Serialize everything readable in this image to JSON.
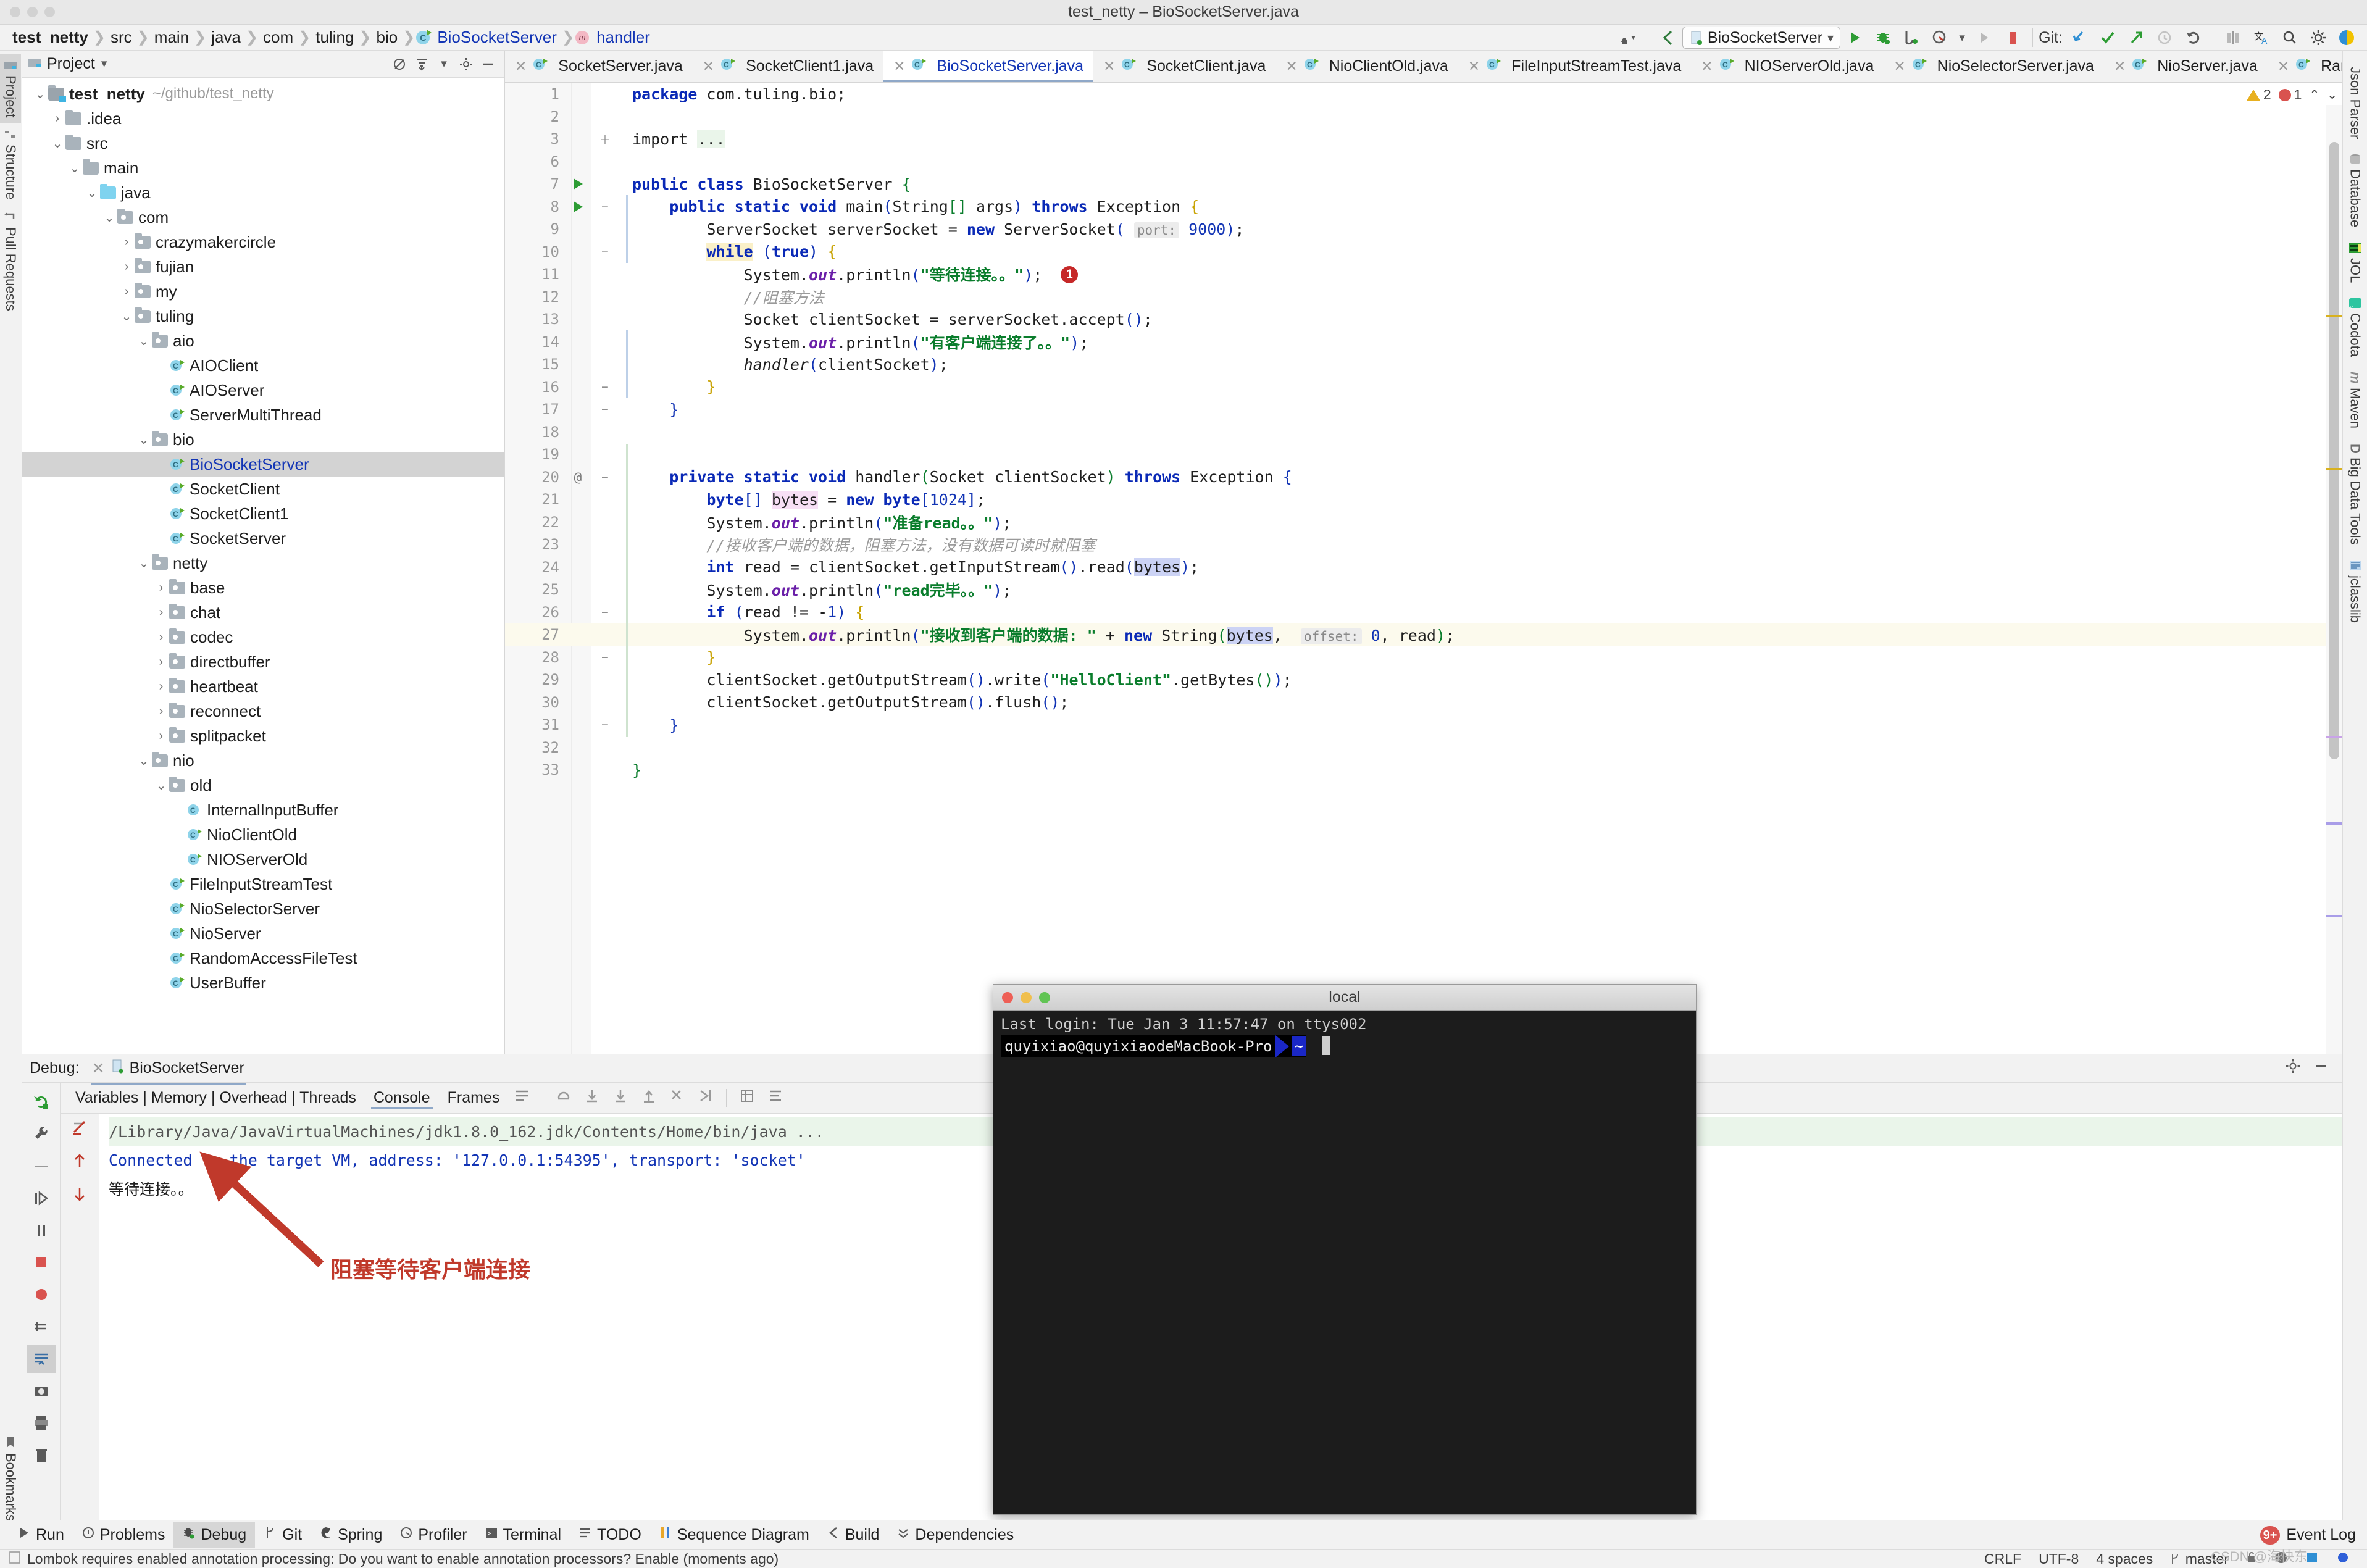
{
  "window": {
    "title": "test_netty – BioSocketServer.java"
  },
  "breadcrumb": {
    "items": [
      {
        "label": "test_netty",
        "kind": "project"
      },
      {
        "label": "src",
        "kind": "dir"
      },
      {
        "label": "main",
        "kind": "dir"
      },
      {
        "label": "java",
        "kind": "dir"
      },
      {
        "label": "com",
        "kind": "dir"
      },
      {
        "label": "tuling",
        "kind": "dir"
      },
      {
        "label": "bio",
        "kind": "dir"
      },
      {
        "label": "BioSocketServer",
        "kind": "class"
      },
      {
        "label": "handler",
        "kind": "method"
      }
    ]
  },
  "toolbar": {
    "run_config": "BioSocketServer",
    "git_label": "Git:",
    "icons": [
      "profiler-icon",
      "back-icon",
      "run-config-dropdown",
      "run-icon",
      "debug-icon",
      "run-with-coverage-icon",
      "profile-icon",
      "rerun-icon",
      "stop-icon",
      "git-update-icon",
      "git-commit-icon",
      "git-push-icon",
      "git-history-icon",
      "git-rollback-icon",
      "diff-icon",
      "translate-icon",
      "search-icon",
      "settings-icon",
      "ide-icon"
    ]
  },
  "left_strip": {
    "items": [
      {
        "label": "Project",
        "icon": "project-icon",
        "active": true
      },
      {
        "label": "Structure",
        "icon": "structure-icon",
        "active": false
      },
      {
        "label": "Pull Requests",
        "icon": "pull-requests-icon",
        "active": false
      },
      {
        "label": "Bookmarks",
        "icon": "bookmarks-icon",
        "active": false
      }
    ]
  },
  "right_strip": {
    "items": [
      {
        "label": "Json Parser",
        "icon": "json-parser-icon"
      },
      {
        "label": "Database",
        "icon": "database-icon"
      },
      {
        "label": "JOL",
        "icon": "jol-icon"
      },
      {
        "label": "Codota",
        "icon": "codota-icon"
      },
      {
        "label": "Maven",
        "icon": "maven-icon"
      },
      {
        "label": "Big Data Tools",
        "icon": "big-data-tools-icon"
      },
      {
        "label": "jclasslib",
        "icon": "jclasslib-icon"
      }
    ]
  },
  "project_panel": {
    "title": "Project",
    "header_icons": [
      "collapse-all-icon",
      "expand-all-icon",
      "options-icon",
      "settings-icon",
      "hide-icon"
    ],
    "tree": [
      {
        "depth": 0,
        "label": "test_netty",
        "sub": "~/github/test_netty",
        "icon": "project-folder",
        "arrow": "down",
        "bold": true
      },
      {
        "depth": 1,
        "label": ".idea",
        "icon": "folder",
        "arrow": "right"
      },
      {
        "depth": 1,
        "label": "src",
        "icon": "folder",
        "arrow": "down"
      },
      {
        "depth": 2,
        "label": "main",
        "icon": "folder",
        "arrow": "down"
      },
      {
        "depth": 3,
        "label": "java",
        "icon": "source-folder",
        "arrow": "down"
      },
      {
        "depth": 4,
        "label": "com",
        "icon": "package",
        "arrow": "down"
      },
      {
        "depth": 5,
        "label": "crazymakercircle",
        "icon": "package",
        "arrow": "right"
      },
      {
        "depth": 5,
        "label": "fujian",
        "icon": "package",
        "arrow": "right"
      },
      {
        "depth": 5,
        "label": "my",
        "icon": "package",
        "arrow": "right"
      },
      {
        "depth": 5,
        "label": "tuling",
        "icon": "package",
        "arrow": "down"
      },
      {
        "depth": 6,
        "label": "aio",
        "icon": "package",
        "arrow": "down"
      },
      {
        "depth": 7,
        "label": "AIOClient",
        "icon": "java-class",
        "arrow": ""
      },
      {
        "depth": 7,
        "label": "AIOServer",
        "icon": "java-class",
        "arrow": ""
      },
      {
        "depth": 7,
        "label": "ServerMultiThread",
        "icon": "java-class",
        "arrow": ""
      },
      {
        "depth": 6,
        "label": "bio",
        "icon": "package",
        "arrow": "down"
      },
      {
        "depth": 7,
        "label": "BioSocketServer",
        "icon": "java-class",
        "arrow": "",
        "selected": true
      },
      {
        "depth": 7,
        "label": "SocketClient",
        "icon": "java-class",
        "arrow": ""
      },
      {
        "depth": 7,
        "label": "SocketClient1",
        "icon": "java-class",
        "arrow": ""
      },
      {
        "depth": 7,
        "label": "SocketServer",
        "icon": "java-class",
        "arrow": ""
      },
      {
        "depth": 6,
        "label": "netty",
        "icon": "package",
        "arrow": "down"
      },
      {
        "depth": 7,
        "label": "base",
        "icon": "package",
        "arrow": "right"
      },
      {
        "depth": 7,
        "label": "chat",
        "icon": "package",
        "arrow": "right"
      },
      {
        "depth": 7,
        "label": "codec",
        "icon": "package",
        "arrow": "right"
      },
      {
        "depth": 7,
        "label": "directbuffer",
        "icon": "package",
        "arrow": "right"
      },
      {
        "depth": 7,
        "label": "heartbeat",
        "icon": "package",
        "arrow": "right"
      },
      {
        "depth": 7,
        "label": "reconnect",
        "icon": "package",
        "arrow": "right"
      },
      {
        "depth": 7,
        "label": "splitpacket",
        "icon": "package",
        "arrow": "right"
      },
      {
        "depth": 6,
        "label": "nio",
        "icon": "package",
        "arrow": "down"
      },
      {
        "depth": 7,
        "label": "old",
        "icon": "package",
        "arrow": "down"
      },
      {
        "depth": 8,
        "label": "InternalInputBuffer",
        "icon": "java-class-plain",
        "arrow": ""
      },
      {
        "depth": 8,
        "label": "NioClientOld",
        "icon": "java-class",
        "arrow": ""
      },
      {
        "depth": 8,
        "label": "NIOServerOld",
        "icon": "java-class",
        "arrow": ""
      },
      {
        "depth": 7,
        "label": "FileInputStreamTest",
        "icon": "java-class",
        "arrow": ""
      },
      {
        "depth": 7,
        "label": "NioSelectorServer",
        "icon": "java-class",
        "arrow": ""
      },
      {
        "depth": 7,
        "label": "NioServer",
        "icon": "java-class",
        "arrow": ""
      },
      {
        "depth": 7,
        "label": "RandomAccessFileTest",
        "icon": "java-class",
        "arrow": ""
      },
      {
        "depth": 7,
        "label": "UserBuffer",
        "icon": "java-class",
        "arrow": ""
      }
    ]
  },
  "editor": {
    "tabs": [
      {
        "label": "SocketServer.java",
        "active": false
      },
      {
        "label": "SocketClient1.java",
        "active": false
      },
      {
        "label": "BioSocketServer.java",
        "active": true
      },
      {
        "label": "SocketClient.java",
        "active": false
      },
      {
        "label": "NioClientOld.java",
        "active": false
      },
      {
        "label": "FileInputStreamTest.java",
        "active": false
      },
      {
        "label": "NIOServerOld.java",
        "active": false
      },
      {
        "label": "NioSelectorServer.java",
        "active": false
      },
      {
        "label": "NioServer.java",
        "active": false
      },
      {
        "label": "RandomA",
        "active": false
      }
    ],
    "inspections": {
      "warnings": "2",
      "errors": "1"
    },
    "line_numbers": [
      1,
      2,
      3,
      6,
      7,
      8,
      9,
      10,
      11,
      12,
      13,
      14,
      15,
      16,
      17,
      18,
      19,
      20,
      21,
      22,
      23,
      24,
      25,
      26,
      27,
      28,
      29,
      30,
      31,
      32,
      33
    ],
    "code_plain": [
      "package com.tuling.bio;",
      "",
      "import ...",
      "",
      "public class BioSocketServer {",
      "    public static void main(String[] args) throws Exception {",
      "        ServerSocket serverSocket = new ServerSocket( port: 9000);",
      "        while (true) {",
      "            System.out.println(\"等待连接。。\");",
      "            //阻塞方法",
      "            Socket clientSocket = serverSocket.accept();",
      "            System.out.println(\"有客户端连接了。。\");",
      "            handler(clientSocket);",
      "        }",
      "    }",
      "",
      "",
      "    private static void handler(Socket clientSocket) throws Exception {",
      "        byte[] bytes = new byte[1024];",
      "        System.out.println(\"准备read。。\");",
      "        //接收客户端的数据，阻塞方法，没有数据可读时就阻塞",
      "        int read = clientSocket.getInputStream().read(bytes);",
      "        System.out.println(\"read完毕。。\");",
      "        if (read != -1) {",
      "            System.out.println(\"接收到客户端的数据: \" + new String(bytes,  offset: 0, read);",
      "        }",
      "        clientSocket.getOutputStream().write(\"HelloClient\".getBytes());",
      "        clientSocket.getOutputStream().flush();",
      "    }",
      "",
      "}"
    ],
    "marker_badge": "1",
    "hints": {
      "port": "port:",
      "offset": "offset:"
    }
  },
  "debug": {
    "label": "Debug:",
    "session": "BioSocketServer",
    "tabs": [
      {
        "label": "Variables | Memory | Overhead | Threads",
        "active": false
      },
      {
        "label": "Console",
        "active": true
      },
      {
        "label": "Frames",
        "active": false
      }
    ],
    "console_lines": [
      {
        "text": "/Library/Java/JavaVirtualMachines/jdk1.8.0_162.jdk/Contents/Home/bin/java ...",
        "kind": "cmd"
      },
      {
        "text": "Connected to the target VM, address: '127.0.0.1:54395', transport: 'socket'",
        "kind": "conn"
      },
      {
        "text": "等待连接。。",
        "kind": "out"
      }
    ],
    "side_icons": [
      "rerun-icon",
      "settings-wrench-icon",
      "mute-icon",
      "resume-icon",
      "pause-icon",
      "stop-icon",
      "view-breakpoints-icon",
      "mute-breakpoints-icon",
      "layout-icon",
      "camera-icon",
      "print-icon",
      "trash-icon"
    ],
    "gutter_icons": [
      "soft-wrap-icon",
      "scroll-to-end-icon",
      "up-icon",
      "down-icon"
    ]
  },
  "annotation": {
    "text": "阻塞等待客户端连接",
    "color": "#c0392b"
  },
  "terminal": {
    "title": "local",
    "last_login": "Last login: Tue Jan  3 11:57:47 on ttys002",
    "prompt_user": "quyixiao@quyixiaodeMacBook-Pro",
    "prompt_tilde": "~"
  },
  "tool_window_bar": {
    "items": [
      {
        "label": "Run",
        "icon": "run-icon",
        "active": false
      },
      {
        "label": "Problems",
        "icon": "problems-icon",
        "active": false
      },
      {
        "label": "Debug",
        "icon": "debug-icon",
        "active": true
      },
      {
        "label": "Git",
        "icon": "git-icon",
        "active": false
      },
      {
        "label": "Spring",
        "icon": "spring-icon",
        "active": false
      },
      {
        "label": "Profiler",
        "icon": "profiler-icon",
        "active": false
      },
      {
        "label": "Terminal",
        "icon": "terminal-icon",
        "active": false
      },
      {
        "label": "TODO",
        "icon": "todo-icon",
        "active": false
      },
      {
        "label": "Sequence Diagram",
        "icon": "sequence-diagram-icon",
        "active": false
      },
      {
        "label": "Build",
        "icon": "build-icon",
        "active": false
      },
      {
        "label": "Dependencies",
        "icon": "dependencies-icon",
        "active": false
      }
    ],
    "event_log": {
      "label": "Event Log",
      "badge": "9+"
    }
  },
  "status_bar": {
    "message": "Lombok requires enabled annotation processing: Do you want to enable annotation processors? Enable (moments ago)",
    "line_sep": "CRLF",
    "encoding": "UTF-8",
    "indent": "4 spaces",
    "branch": "master",
    "watermark": "CSDN @海快东"
  }
}
